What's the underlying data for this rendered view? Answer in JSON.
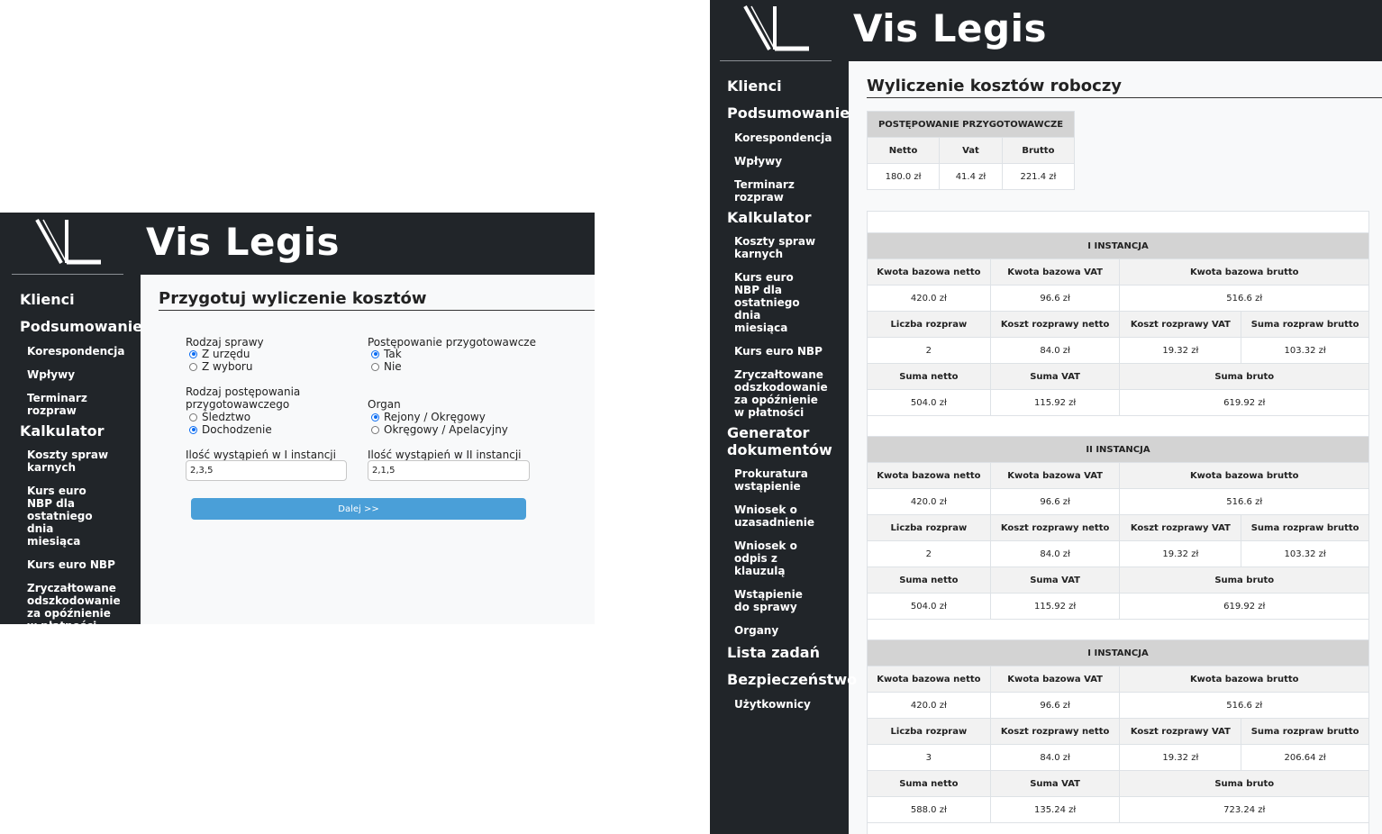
{
  "brand": {
    "name": "Vis Legis"
  },
  "nav": {
    "klienci": "Klienci",
    "podsumowanie": "Podsumowanie",
    "korespondencja": "Korespondencja",
    "wplywy": "Wpływy",
    "terminarz": "Terminarz rozpraw",
    "kalkulator": "Kalkulator",
    "koszty": "Koszty spraw karnych",
    "kurs_nbp_last": "Kurs euro NBP dla ostatniego dnia miesiąca",
    "kurs_nbp": "Kurs euro NBP",
    "zryczaltowane": "Zryczałtowane odszkodowanie za opóźnienie w płatności",
    "generator": "Generator dokumentów",
    "prokuratura": "Prokuratura wstąpienie",
    "wniosek_uzas": "Wniosek o uzasadnienie",
    "wniosek_odpis": "Wniosek o odpis z klauzulą",
    "wstapienie": "Wstąpienie do sprawy",
    "organy": "Organy",
    "lista_zadan": "Lista zadań",
    "bezpieczenstwo": "Bezpieczeństwo",
    "uzytkownicy": "Użytkownicy"
  },
  "left": {
    "title": "Przygotuj wyliczenie kosztów",
    "rodzaj_sprawy": {
      "label": "Rodzaj sprawy",
      "opt1": "Z urzędu",
      "opt2": "Z wyboru"
    },
    "postepowanie": {
      "label": "Postępowanie przygotowawcze",
      "opt1": "Tak",
      "opt2": "Nie"
    },
    "rodzaj_post": {
      "label1": "Rodzaj postępowania",
      "label2": "przygotowawczego",
      "opt1": "Śledztwo",
      "opt2": "Dochodzenie"
    },
    "organ": {
      "label": "Organ",
      "opt1": "Rejony / Okręgowy",
      "opt2": "Okręgowy / Apelacyjny"
    },
    "ilosc1": {
      "label": "Ilość wystąpień w I instancji",
      "value": "2,3,5"
    },
    "ilosc2": {
      "label": "Ilość wystąpień w II instancji",
      "value": "2,1,5"
    },
    "next_button": "Dalej >>"
  },
  "right": {
    "title": "Wyliczenie kosztów roboczy",
    "prep": {
      "header": "POSTĘPOWANIE PRZYGOTOWAWCZE",
      "cols": [
        "Netto",
        "Vat",
        "Brutto"
      ],
      "values": [
        "180.0 zł",
        "41.4 zł",
        "221.4 zł"
      ]
    },
    "headers": {
      "kwota_netto": "Kwota bazowa netto",
      "kwota_vat": "Kwota bazowa VAT",
      "kwota_brutto": "Kwota bazowa brutto",
      "liczba": "Liczba rozpraw",
      "koszt_netto": "Koszt rozprawy netto",
      "koszt_vat": "Koszt rozprawy VAT",
      "suma_rozpraw": "Suma rozpraw brutto",
      "suma_netto": "Suma netto",
      "suma_vat": "Suma VAT",
      "suma_bruto": "Suma bruto"
    },
    "blocks": [
      {
        "title": "I INSTANCJA",
        "kwota": [
          "420.0 zł",
          "96.6 zł",
          "516.6 zł"
        ],
        "rozprawy": [
          "2",
          "84.0 zł",
          "19.32 zł",
          "103.32 zł"
        ],
        "sumy": [
          "504.0 zł",
          "115.92 zł",
          "619.92 zł"
        ]
      },
      {
        "title": "II INSTANCJA",
        "kwota": [
          "420.0 zł",
          "96.6 zł",
          "516.6 zł"
        ],
        "rozprawy": [
          "2",
          "84.0 zł",
          "19.32 zł",
          "103.32 zł"
        ],
        "sumy": [
          "504.0 zł",
          "115.92 zł",
          "619.92 zł"
        ]
      },
      {
        "title": "I INSTANCJA",
        "kwota": [
          "420.0 zł",
          "96.6 zł",
          "516.6 zł"
        ],
        "rozprawy": [
          "3",
          "84.0 zł",
          "19.32 zł",
          "206.64 zł"
        ],
        "sumy": [
          "588.0 zł",
          "135.24 zł",
          "723.24 zł"
        ]
      }
    ]
  }
}
